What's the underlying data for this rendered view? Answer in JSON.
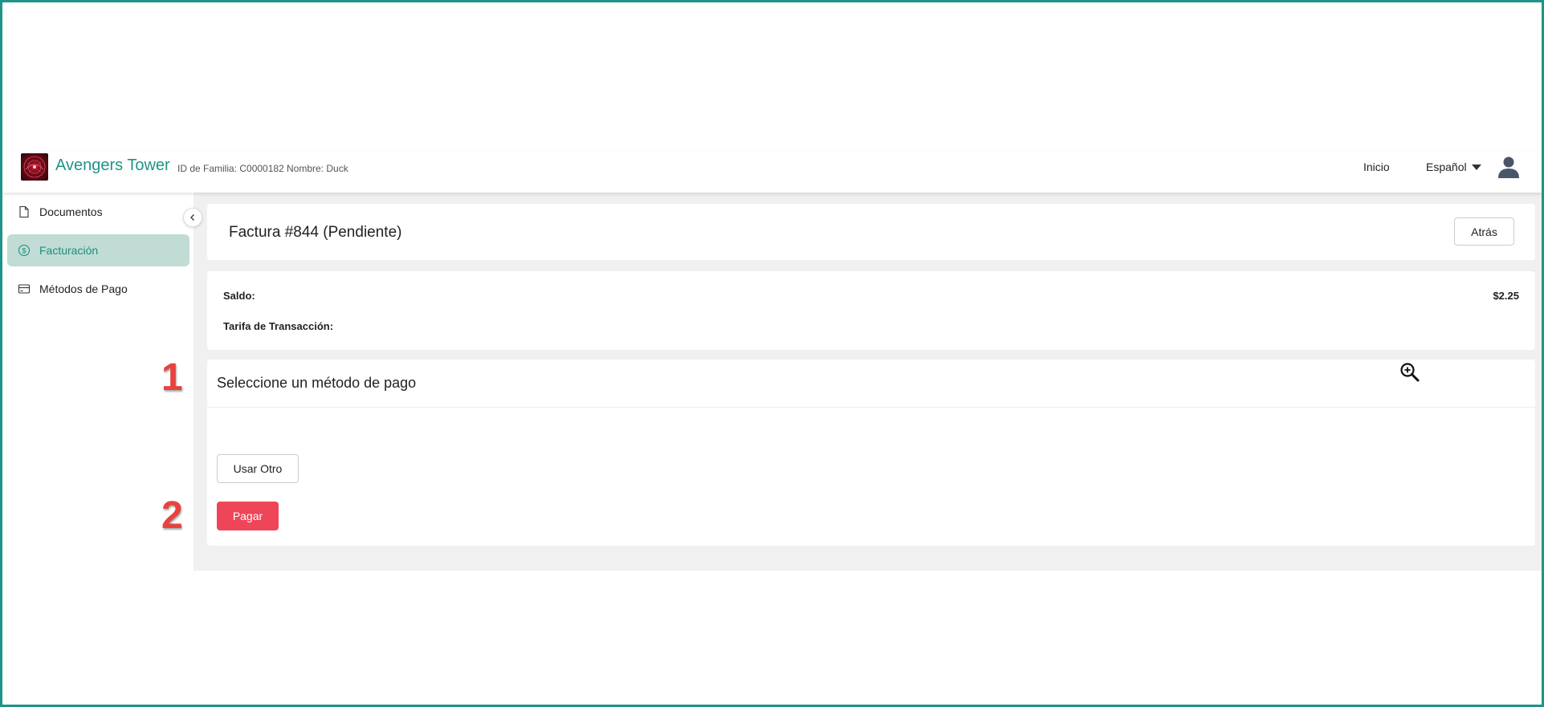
{
  "header": {
    "app_title": "Avengers Tower",
    "family_id": "ID de Familia: C0000182",
    "family_name": "Nombre: Duck",
    "nav_home": "Inicio",
    "language": "Español"
  },
  "sidebar": {
    "items": [
      {
        "label": "Documentos",
        "icon": "document-icon",
        "active": false
      },
      {
        "label": "Facturación",
        "icon": "dollar-circle-icon",
        "active": true
      },
      {
        "label": "Métodos de Pago",
        "icon": "credit-card-icon",
        "active": false
      }
    ]
  },
  "invoice": {
    "title": "Factura #844 (Pendiente)",
    "back_label": "Atrás",
    "balance_label": "Saldo:",
    "balance_value": "$2.25",
    "fee_label": "Tarifa de Transacción:"
  },
  "payment": {
    "section_title": "Seleccione un método de pago",
    "use_other_label": "Usar Otro",
    "pay_label": "Pagar"
  },
  "annotations": {
    "step1": "1",
    "step2": "2"
  },
  "colors": {
    "brand": "#1f9488",
    "active_bg": "#c0dcd5",
    "pay_button": "#ef4559",
    "annotation": "#e8423f"
  }
}
